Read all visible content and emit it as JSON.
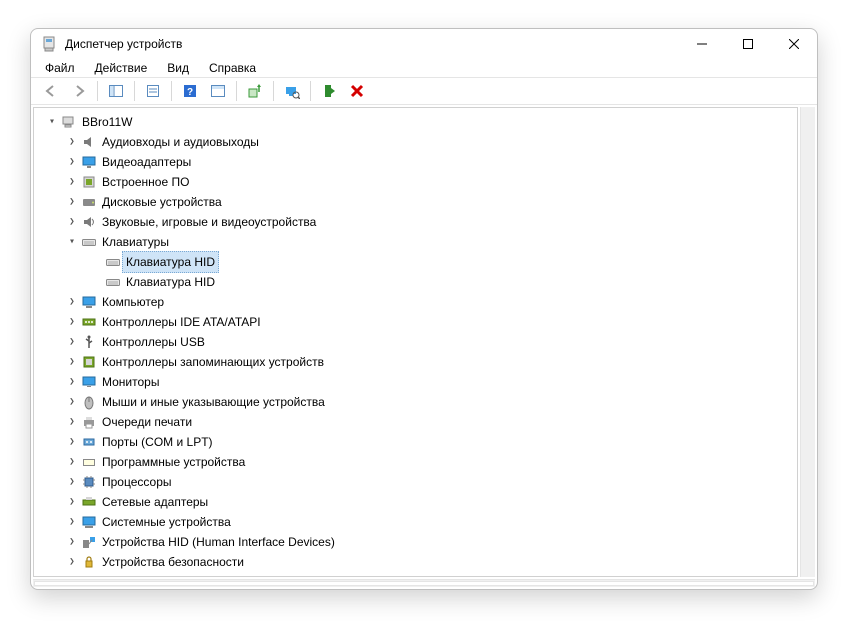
{
  "window": {
    "title": "Диспетчер устройств"
  },
  "menu": {
    "file": "Файл",
    "action": "Действие",
    "view": "Вид",
    "help": "Справка"
  },
  "tree": {
    "root": "BBro11W",
    "items": [
      {
        "label": "Аудиовходы и аудиовыходы",
        "icon": "audio"
      },
      {
        "label": "Видеоадаптеры",
        "icon": "display"
      },
      {
        "label": "Встроенное ПО",
        "icon": "firmware"
      },
      {
        "label": "Дисковые устройства",
        "icon": "disk"
      },
      {
        "label": "Звуковые, игровые и видеоустройства",
        "icon": "sound"
      },
      {
        "label": "Клавиатуры",
        "icon": "keyboard",
        "expanded": true,
        "children": [
          {
            "label": "Клавиатура HID",
            "icon": "keyboard",
            "selected": true
          },
          {
            "label": "Клавиатура HID",
            "icon": "keyboard"
          }
        ]
      },
      {
        "label": "Компьютер",
        "icon": "computer"
      },
      {
        "label": "Контроллеры IDE ATA/ATAPI",
        "icon": "ide"
      },
      {
        "label": "Контроллеры USB",
        "icon": "usb"
      },
      {
        "label": "Контроллеры запоминающих устройств",
        "icon": "storagectl"
      },
      {
        "label": "Мониторы",
        "icon": "monitor"
      },
      {
        "label": "Мыши и иные указывающие устройства",
        "icon": "mouse"
      },
      {
        "label": "Очереди печати",
        "icon": "printer"
      },
      {
        "label": "Порты (COM и LPT)",
        "icon": "port"
      },
      {
        "label": "Программные устройства",
        "icon": "software"
      },
      {
        "label": "Процессоры",
        "icon": "cpu"
      },
      {
        "label": "Сетевые адаптеры",
        "icon": "network"
      },
      {
        "label": "Системные устройства",
        "icon": "system"
      },
      {
        "label": "Устройства HID (Human Interface Devices)",
        "icon": "hid"
      },
      {
        "label": "Устройства безопасности",
        "icon": "security"
      }
    ]
  }
}
